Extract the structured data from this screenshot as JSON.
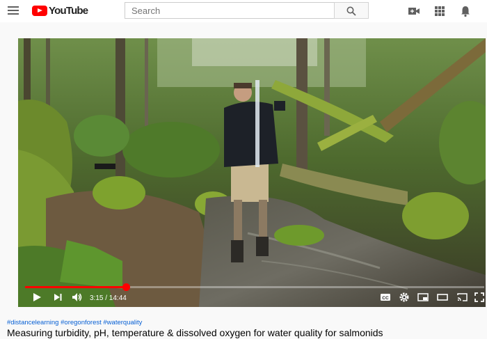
{
  "header": {
    "logo_text": "YouTube",
    "search_placeholder": "Search",
    "icons": [
      "menu-icon",
      "search-icon",
      "create-video-icon",
      "apps-icon",
      "notifications-icon"
    ]
  },
  "player": {
    "current_time": "3:15",
    "duration": "14:44",
    "time_display": "3:15 / 14:44",
    "progress_fraction": 0.22,
    "accent_color": "#ff0000",
    "control_icons": [
      "play-icon",
      "next-icon",
      "volume-icon",
      "subtitles-icon",
      "settings-icon",
      "miniplayer-icon",
      "theater-icon",
      "cast-icon",
      "fullscreen-icon"
    ]
  },
  "video_info": {
    "hashtags": [
      "#distancelearning",
      "#oregonforest",
      "#waterquality"
    ],
    "title": "Measuring turbidity, pH, temperature & dissolved oxygen for water quality for salmonids"
  }
}
